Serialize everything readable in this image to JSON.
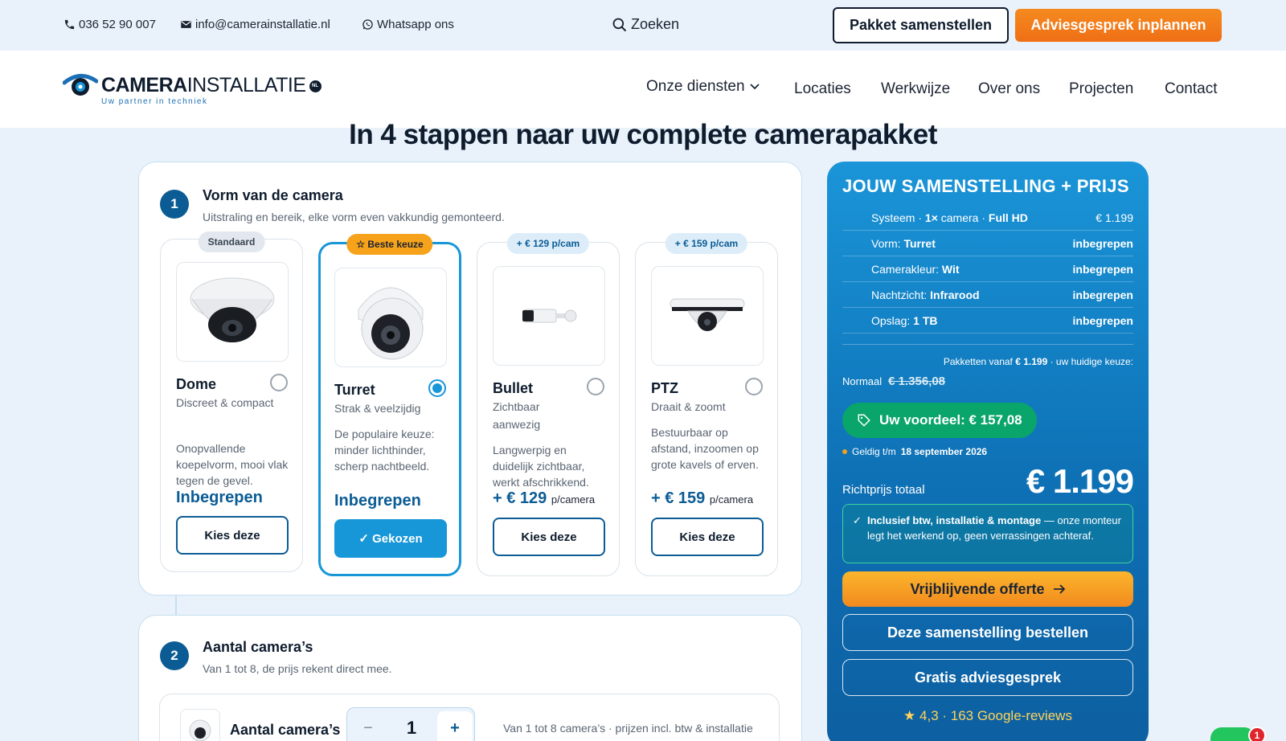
{
  "topbar": {
    "phone": "036 52 90 007",
    "email": "info@camerainstallatie.nl",
    "whatsapp": "Whatsapp ons",
    "search": "Zoeken",
    "btn_pakket": "Pakket samenstellen",
    "btn_advies": "Adviesgesprek inplannen"
  },
  "logo": {
    "bold": "CAMERA",
    "rest": "INSTALLATIE",
    "badge": "NL",
    "tagline": "Uw partner in techniek"
  },
  "nav": {
    "items": [
      "Onze diensten",
      "Locaties",
      "Werkwijze",
      "Over ons",
      "Projecten",
      "Contact"
    ]
  },
  "heading": "In 4 stappen naar uw complete camerapakket",
  "step1": {
    "num": "1",
    "title": "Vorm van de camera",
    "subtitle": "Uitstraling en bereik, elke vorm even vakkundig gemonteerd.",
    "options": [
      {
        "badge": "Standaard",
        "name": "Dome",
        "tagline": "Discreet & compact",
        "desc": "Onopvallende koepelvorm, mooi vlak tegen de gevel.",
        "price": "Inbegrepen",
        "unit": "",
        "cta": "Kies deze",
        "selected": false
      },
      {
        "badge": "☆ Beste keuze",
        "name": "Turret",
        "tagline": "Strak & veelzijdig",
        "desc": "De populaire keuze: minder lichthinder, scherp nachtbeeld.",
        "price": "Inbegrepen",
        "unit": "",
        "cta": "✓ Gekozen",
        "selected": true
      },
      {
        "badge": "+ € 129 p/cam",
        "name": "Bullet",
        "tagline": "Zichtbaar aanwezig",
        "desc": "Langwerpig en duidelijk zichtbaar, werkt afschrikkend.",
        "price": "+ € 129",
        "unit": "p/camera",
        "cta": "Kies deze",
        "selected": false
      },
      {
        "badge": "+ € 159 p/cam",
        "name": "PTZ",
        "tagline": "Draait & zoomt",
        "desc": "Bestuurbaar op afstand, inzoomen op grote kavels of erven.",
        "price": "+ € 159",
        "unit": "p/camera",
        "cta": "Kies deze",
        "selected": false
      }
    ]
  },
  "step2": {
    "num": "2",
    "title": "Aantal camera’s",
    "subtitle": "Van 1 tot 8, de prijs rekent direct mee.",
    "label": "Aantal camera’s",
    "minus": "−",
    "value": "1",
    "plus": "+",
    "note": "Van 1 tot 8 camera’s · prijzen incl. btw & installatie"
  },
  "summary": {
    "title": "JOUW SAMENSTELLING + PRIJS",
    "rows": [
      {
        "label": "Systeem · ",
        "value": "1×",
        "mid": " camera · ",
        "value2": "Full HD",
        "right": "€ 1.199"
      },
      {
        "label": "Vorm: ",
        "value": "Turret",
        "mid": "",
        "value2": "",
        "right": "inbegrepen"
      },
      {
        "label": "Camerakleur: ",
        "value": "Wit",
        "mid": "",
        "value2": "",
        "right": "inbegrepen"
      },
      {
        "label": "Nachtzicht: ",
        "value": "Infrarood",
        "mid": "",
        "value2": "",
        "right": "inbegrepen"
      },
      {
        "label": "Opslag: ",
        "value": "1 TB",
        "mid": "",
        "value2": "",
        "right": "inbegrepen"
      }
    ],
    "from_text": "Pakketten vanaf ",
    "from_value": "€ 1.199",
    "from_tail": " · uw huidige keuze:",
    "normal_label": "Normaal",
    "normal_price": "€ 1.356,08",
    "voordeel": "Uw voordeel:  € 157,08",
    "valid_label": "Geldig t/m ",
    "valid_date": "18 september 2026",
    "total_label": "Richtprijs totaal",
    "total": "€ 1.199",
    "incl_bold": "Inclusief btw, installatie & montage",
    "incl_rest": " — onze monteur legt het werkend op, geen verrassingen achteraf.",
    "btn_offerte": "Vrijblijvende offerte",
    "btn_bestellen": "Deze samenstelling bestellen",
    "btn_gesprek": "Gratis adviesgesprek",
    "reviews": "★ 4,3 · 163 Google-reviews"
  },
  "chat": {
    "count": "1"
  },
  "colors": {
    "brand": "#0b5c95",
    "accent": "#1797d8",
    "orange": "#f28a1e",
    "green": "#0aa56a"
  }
}
